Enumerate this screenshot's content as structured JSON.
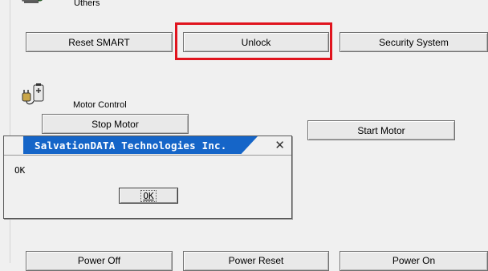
{
  "sections": {
    "others": {
      "label": "Uthers",
      "icon": "drive-tools-icon",
      "buttons": [
        "Reset SMART",
        "Unlock",
        "Security System"
      ]
    },
    "motor": {
      "label": "Motor Control",
      "icon": "power-plug-battery-icon",
      "buttons": [
        "Stop Motor",
        "Start Motor"
      ]
    },
    "power": {
      "buttons": [
        "Power Off",
        "Power Reset",
        "Power On"
      ]
    }
  },
  "dialog": {
    "title": "SalvationDATA Technologies Inc.",
    "message": "OK",
    "ok_label": "OK",
    "close_icon": "close-icon",
    "title_color": "#1565c8"
  },
  "highlight_color": "#e0141e"
}
